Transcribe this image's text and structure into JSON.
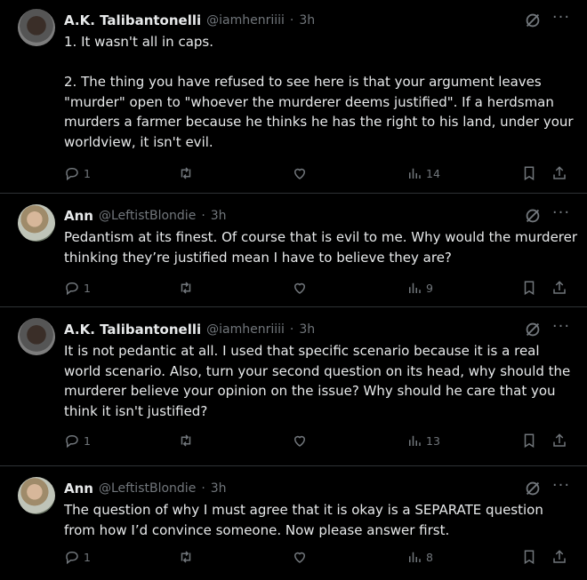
{
  "tweets": [
    {
      "author": "A.K. Talibantonelli",
      "handle": "@iamhenriiii",
      "separator": "·",
      "time": "3h",
      "text": "1. It wasn't all in caps.\n\n2. The thing you have refused to see here is that your argument leaves \"murder\" open to \"whoever the murderer deems justified\". If a herdsman murders a farmer because he thinks he has the right to his land, under your worldview, it isn't evil.",
      "replies": "1",
      "retweets": "",
      "likes": "",
      "views": "14",
      "more": "···"
    },
    {
      "author": "Ann",
      "handle": "@LeftistBlondie",
      "separator": "·",
      "time": "3h",
      "text": "Pedantism at its finest. Of course that is evil to me. Why would the murderer thinking they’re justified mean I have to believe they are?",
      "replies": "1",
      "retweets": "",
      "likes": "",
      "views": "9",
      "more": "···"
    },
    {
      "author": "A.K. Talibantonelli",
      "handle": "@iamhenriiii",
      "separator": "·",
      "time": "3h",
      "text": "It is not pedantic at all. I used that specific scenario because it is a real world scenario. Also, turn your second question on its head, why should the murderer believe your opinion on the issue? Why should he care that you think it isn't justified?",
      "replies": "1",
      "retweets": "",
      "likes": "",
      "views": "13",
      "more": "···"
    },
    {
      "author": "Ann",
      "handle": "@LeftistBlondie",
      "separator": "·",
      "time": "3h",
      "text": "The question of why I must agree that it is okay is a SEPARATE question from how I’d convince someone. Now please answer first.",
      "replies": "1",
      "retweets": "",
      "likes": "",
      "views": "8",
      "more": "···"
    }
  ],
  "colors": {
    "background": "#000000",
    "text": "#e7e9ea",
    "muted": "#71767b",
    "divider": "#2f3336"
  },
  "icons": [
    "reply-icon",
    "retweet-icon",
    "like-icon",
    "views-icon",
    "bookmark-icon",
    "share-icon",
    "grok-icon",
    "more-icon"
  ]
}
